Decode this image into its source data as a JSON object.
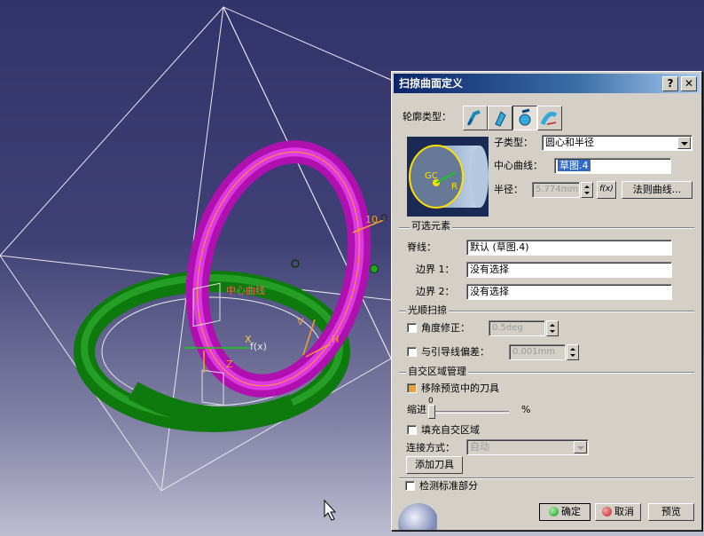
{
  "viewport": {
    "labels": {
      "center_curve": "中心曲线",
      "radius_value": "10",
      "guide_label": "GC",
      "r_label": "R",
      "axis_x": "X",
      "axis_z": "Z",
      "axis_h": "H",
      "axis_v": "V",
      "fx": "f(x)"
    },
    "colors": {
      "magenta_torus": "#d21ad2",
      "green_torus": "#0e7a0e",
      "background": "#3a3a70"
    }
  },
  "dialog": {
    "title": "扫掠曲面定义",
    "help_icon": "?",
    "close_icon": "✕",
    "profile_type_label": "轮廓类型：",
    "profile_types": [
      "explicit-icon",
      "line-icon",
      "circle-icon",
      "conic-icon"
    ],
    "subtype_label": "子类型：",
    "subtype_value": "圆心和半径",
    "center_curve_label": "中心曲线：",
    "center_curve_value": "草图.4",
    "radius_label": "半径：",
    "radius_value": "5.774mm",
    "fx_button": "f(x)",
    "law_curve_button": "法则曲线...",
    "optional_elements_title": "可选元素",
    "spine_label": "脊线：",
    "spine_value": "默认 (草图.4)",
    "boundary1_label": "边界 1：",
    "boundary1_value": "没有选择",
    "boundary2_label": "边界 2：",
    "boundary2_value": "没有选择",
    "smooth_sweep_title": "光顺扫掠",
    "angle_correction_label": "角度修正：",
    "angle_correction_value": "0.5deg",
    "deviation_label": "与引导线偏差：",
    "deviation_value": "0.001mm",
    "self_intersection_title": "自交区域管理",
    "remove_tools_label": "移除预览中的刀具",
    "shrink_label": "缩进",
    "shrink_value": "0",
    "shrink_unit": "%",
    "fill_label": "填充自交区域",
    "connection_label": "连接方式：",
    "connection_value": "自动",
    "add_tool_button": "添加刀具",
    "detect_label": "检测标准部分",
    "ok_button": "确定",
    "cancel_button": "取消",
    "preview_button": "预览",
    "preview_image_labels": {
      "gc": "GC",
      "r": "R"
    }
  }
}
